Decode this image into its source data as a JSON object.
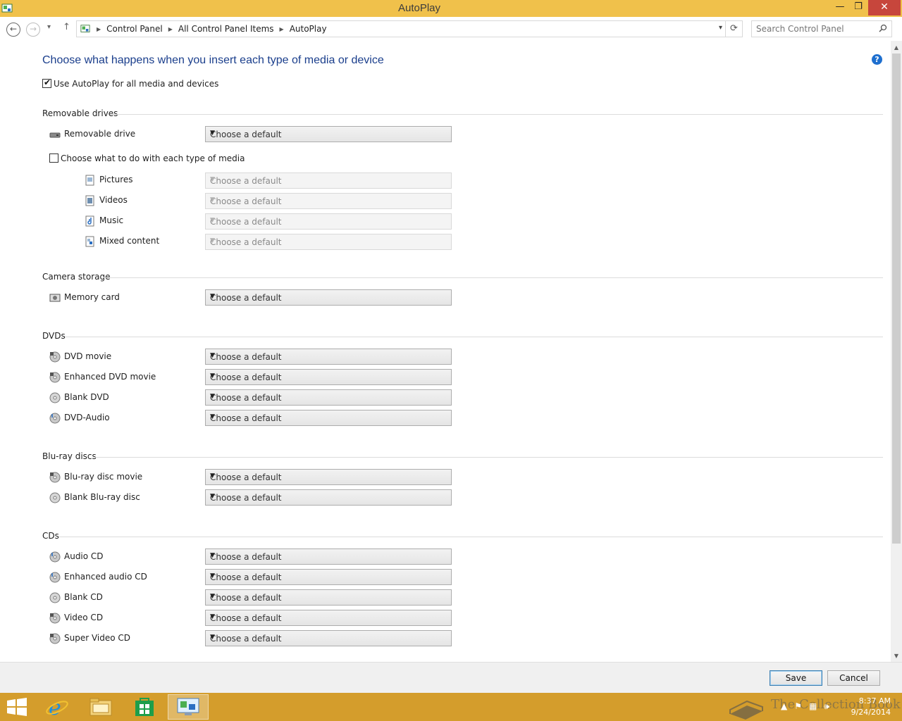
{
  "window": {
    "title": "AutoPlay",
    "minimize": "—",
    "restore": "❐",
    "close": "✕"
  },
  "address": {
    "back": "←",
    "forward": "→",
    "recent": "▾",
    "up": "↑",
    "crumbs": [
      "Control Panel",
      "All Control Panel Items",
      "AutoPlay"
    ],
    "dropdown": "▾",
    "refresh": "⟳",
    "search_placeholder": "Search Control Panel"
  },
  "main": {
    "heading": "Choose what happens when you insert each type of media or device",
    "help": "?",
    "use_autoplay": {
      "label": "Use AutoPlay for all media and devices",
      "checked": true
    },
    "default_choice": "Choose a default",
    "sections": {
      "removable": {
        "title": "Removable drives",
        "removable_drive": "Removable drive",
        "each_type": {
          "label": "Choose what to do with each type of media",
          "checked": false
        },
        "pictures": "Pictures",
        "videos": "Videos",
        "music": "Music",
        "mixed": "Mixed content"
      },
      "camera": {
        "title": "Camera storage",
        "memory_card": "Memory card"
      },
      "dvds": {
        "title": "DVDs",
        "dvd_movie": "DVD movie",
        "enhanced_dvd_movie": "Enhanced DVD movie",
        "blank_dvd": "Blank DVD",
        "dvd_audio": "DVD-Audio"
      },
      "bluray": {
        "title": "Blu-ray discs",
        "bluray_movie": "Blu-ray disc movie",
        "blank_bluray": "Blank Blu-ray disc"
      },
      "cds": {
        "title": "CDs",
        "audio_cd": "Audio CD",
        "enhanced_audio_cd": "Enhanced audio CD",
        "blank_cd": "Blank CD",
        "video_cd": "Video CD",
        "super_video_cd": "Super Video CD"
      }
    }
  },
  "buttons": {
    "save": "Save",
    "cancel": "Cancel"
  },
  "taskbar": {
    "time": "8:37 AM",
    "date": "9/24/2014",
    "watermark": "The Collection Book"
  },
  "colors": {
    "titlebar": "#f0c14b",
    "taskbar": "#d49d2c",
    "heading": "#1a3e8c",
    "close": "#c7463c"
  }
}
